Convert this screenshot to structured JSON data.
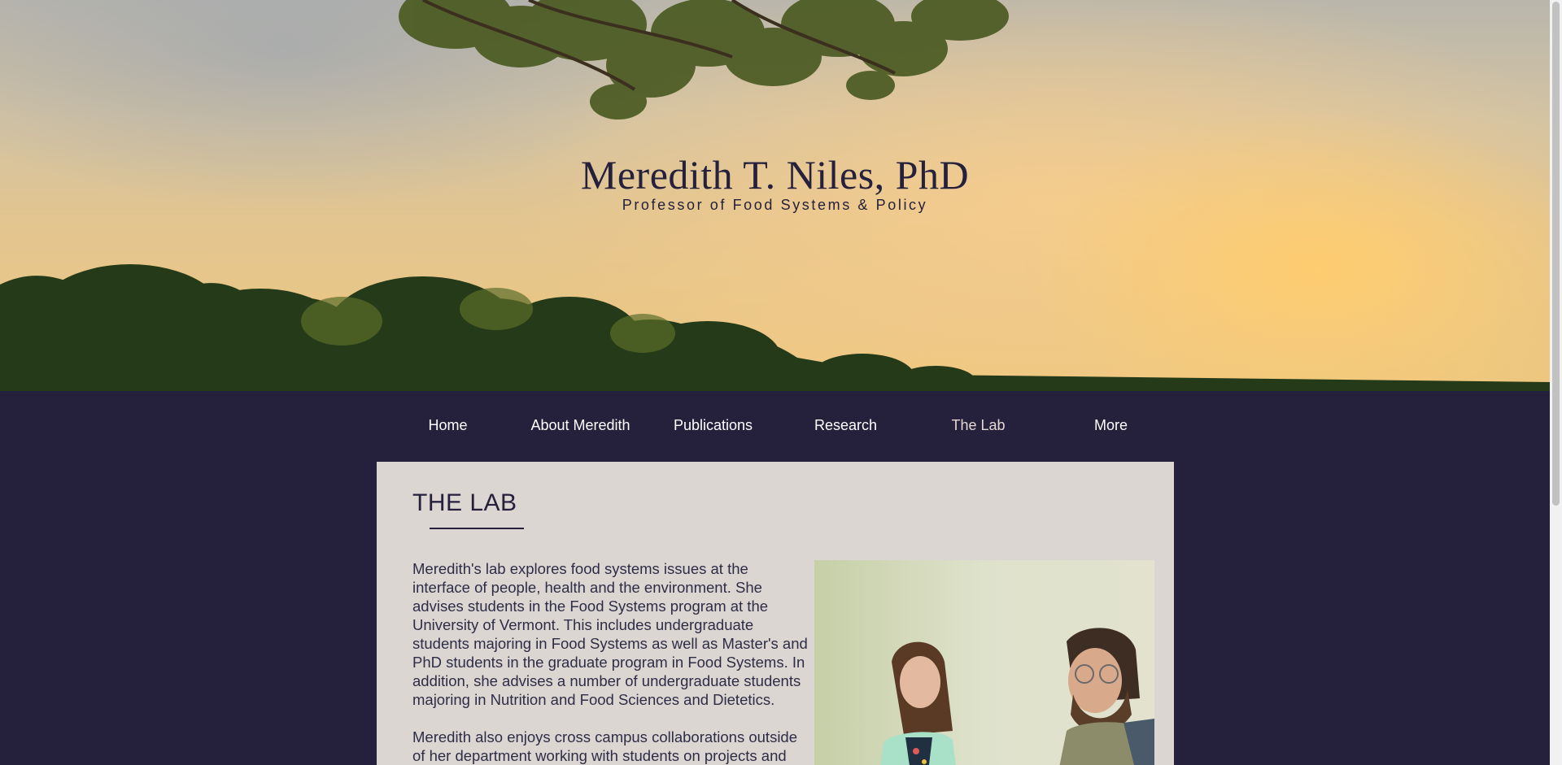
{
  "header": {
    "title": "Meredith T. Niles, PhD",
    "subtitle": "Professor of Food Systems & Policy"
  },
  "nav": {
    "items": [
      {
        "label": "Home",
        "active": false
      },
      {
        "label": "About Meredith",
        "active": false
      },
      {
        "label": "Publications",
        "active": false
      },
      {
        "label": "Research",
        "active": false
      },
      {
        "label": "The Lab",
        "active": true
      },
      {
        "label": "More",
        "active": false
      }
    ]
  },
  "main": {
    "section_title": "THE LAB",
    "paragraphs": [
      "Meredith's lab explores food systems issues at the interface of people, health and the environment.  She advises students in the Food Systems program at the University of Vermont. This includes undergraduate students majoring in Food Systems as well as Master's and PhD students in the graduate program in Food Systems.  In addition, she advises a number of undergraduate students majoring in Nutrition and Food Sciences and Dietetics.",
      "Meredith also enjoys cross campus collaborations outside of her department working with students on projects and"
    ]
  },
  "colors": {
    "navy": "#25203c",
    "panel": "#dcd6d3",
    "active_nav": "#e4d8d2"
  }
}
